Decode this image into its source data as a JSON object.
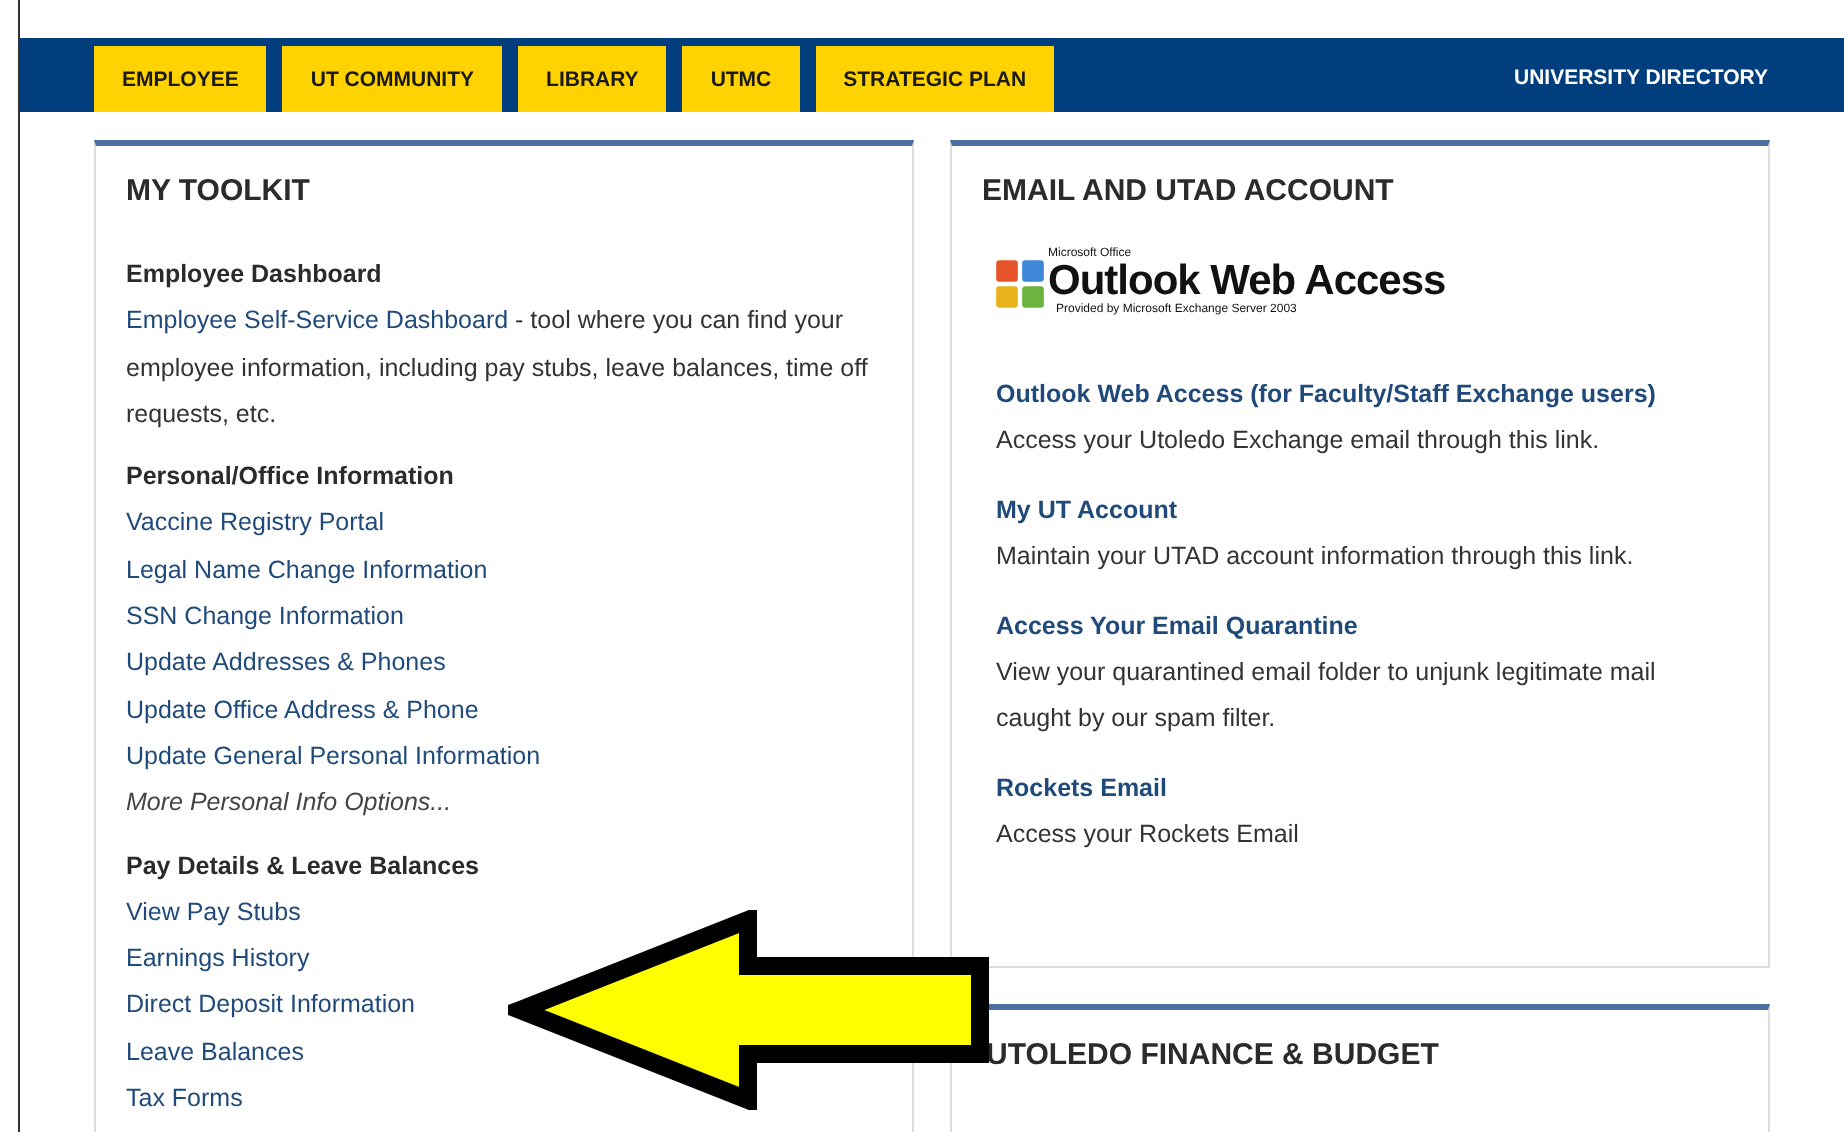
{
  "nav": {
    "tabs": [
      {
        "label": "EMPLOYEE"
      },
      {
        "label": "UT COMMUNITY"
      },
      {
        "label": "LIBRARY"
      },
      {
        "label": "UTMC"
      },
      {
        "label": "STRATEGIC PLAN"
      }
    ],
    "directory_link": "UNIVERSITY DIRECTORY"
  },
  "toolkit": {
    "title": "MY TOOLKIT",
    "sections": [
      {
        "heading": "Employee Dashboard",
        "intro": {
          "link": "Employee Self-Service Dashboard",
          "text": " -  tool where you can find your employee information, including pay stubs, leave balances, time off requests, etc."
        }
      },
      {
        "heading": "Personal/Office Information",
        "items": [
          {
            "label": "Vaccine Registry Portal",
            "kind": "link"
          },
          {
            "label": "Legal Name Change Information",
            "kind": "link"
          },
          {
            "label": "SSN Change Information",
            "kind": "link"
          },
          {
            "label": "Update Addresses & Phones",
            "kind": "link"
          },
          {
            "label": "Update Office Address & Phone",
            "kind": "link"
          },
          {
            "label": "Update General Personal Information",
            "kind": "link"
          },
          {
            "label": "More Personal Info Options...",
            "kind": "more"
          }
        ]
      },
      {
        "heading": "Pay Details & Leave Balances",
        "items": [
          {
            "label": "View Pay Stubs",
            "kind": "link"
          },
          {
            "label": "Earnings History",
            "kind": "link"
          },
          {
            "label": "Direct Deposit Information",
            "kind": "link"
          },
          {
            "label": "Leave Balances",
            "kind": "link"
          },
          {
            "label": "Tax Forms",
            "kind": "link"
          }
        ]
      }
    ]
  },
  "email": {
    "title": "EMAIL AND UTAD ACCOUNT",
    "logo": {
      "top": "Microsoft Office",
      "name": "Outlook Web Access",
      "sub": "Provided by Microsoft Exchange Server 2003"
    },
    "entries": [
      {
        "link": "Outlook Web Access (for Faculty/Staff Exchange users)",
        "description": "Access your Utoledo Exchange email through this link."
      },
      {
        "link": "My UT Account",
        "description": "Maintain your UTAD account information through this link."
      },
      {
        "link": "Access Your Email Quarantine",
        "description": "View your quarantined email folder to unjunk legitimate mail caught by our spam filter."
      },
      {
        "link": "Rockets Email",
        "description": "Access your Rockets Email"
      }
    ]
  },
  "finance": {
    "title": "UTOLEDO FINANCE & BUDGET"
  }
}
